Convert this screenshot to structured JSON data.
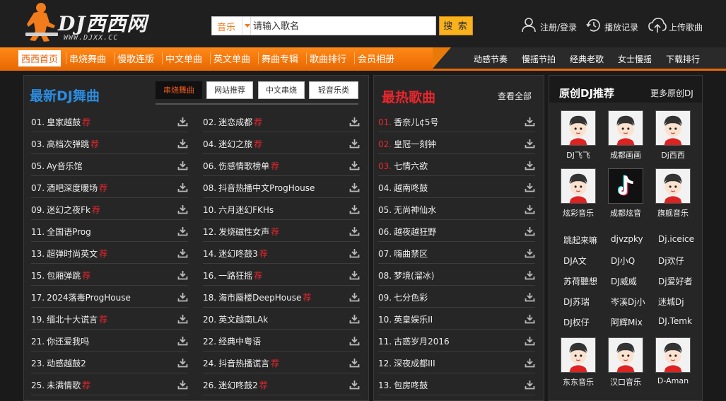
{
  "logo": {
    "text": "DJ西西网",
    "sub": "WWW.DJXX.CC"
  },
  "search": {
    "type_label": "音乐",
    "placeholder": "请输入歌名",
    "button": "搜 索"
  },
  "header_links": [
    {
      "label": "注册/登录",
      "icon": "user-icon"
    },
    {
      "label": "播放记录",
      "icon": "clock-icon"
    },
    {
      "label": "上传歌曲",
      "icon": "upload-icon"
    }
  ],
  "nav": {
    "main": [
      "西西首页",
      "串烧舞曲",
      "慢歌连版",
      "中文单曲",
      "英文单曲",
      "舞曲专辑",
      "歌曲排行",
      "会员相册"
    ],
    "right": [
      "动感节奏",
      "慢摇节拍",
      "经典老歌",
      "女士慢摇",
      "下载排行"
    ]
  },
  "latest": {
    "title": "最新DJ舞曲",
    "tabs": [
      "串烧舞曲",
      "网站推荐",
      "中文串烧",
      "轻音乐类"
    ],
    "rec_mark": "荐",
    "songs": [
      {
        "rank": "01.",
        "title": "皇家越鼓",
        "rec": true
      },
      {
        "rank": "02.",
        "title": "迷恋成都",
        "rec": true
      },
      {
        "rank": "03.",
        "title": "高档次弹跳",
        "rec": true
      },
      {
        "rank": "04.",
        "title": "迷幻之旅",
        "rec": true
      },
      {
        "rank": "05.",
        "title": "Ay音乐馆",
        "rec": false
      },
      {
        "rank": "06.",
        "title": "伤感情歌榜单",
        "rec": true
      },
      {
        "rank": "07.",
        "title": "酒吧深度暖场",
        "rec": true
      },
      {
        "rank": "08.",
        "title": "抖音热播中文ProgHouse",
        "rec": false
      },
      {
        "rank": "09.",
        "title": "迷幻之夜Fk",
        "rec": true
      },
      {
        "rank": "10.",
        "title": "六月迷幻FKHs",
        "rec": false
      },
      {
        "rank": "11.",
        "title": "全国语Prog",
        "rec": false
      },
      {
        "rank": "12.",
        "title": "发烧磁性女声",
        "rec": true
      },
      {
        "rank": "13.",
        "title": "超弹时尚英文",
        "rec": true
      },
      {
        "rank": "14.",
        "title": "迷幻咚鼓3",
        "rec": true
      },
      {
        "rank": "15.",
        "title": "包厢弹跳",
        "rec": true
      },
      {
        "rank": "16.",
        "title": "一路狂摇",
        "rec": true
      },
      {
        "rank": "17.",
        "title": "2024落毒ProgHouse",
        "rec": false
      },
      {
        "rank": "18.",
        "title": "海市蜃楼DeepHouse",
        "rec": true
      },
      {
        "rank": "19.",
        "title": "缅北十大谎言",
        "rec": true
      },
      {
        "rank": "20.",
        "title": "英文越南LAk",
        "rec": false
      },
      {
        "rank": "21.",
        "title": "你还爱我吗",
        "rec": false
      },
      {
        "rank": "22.",
        "title": "经典中粤语",
        "rec": false
      },
      {
        "rank": "23.",
        "title": "动感越鼓2",
        "rec": false
      },
      {
        "rank": "24.",
        "title": "抖音热播谎言",
        "rec": true
      },
      {
        "rank": "25.",
        "title": "未满情歌",
        "rec": true
      },
      {
        "rank": "26.",
        "title": "迷幻咚鼓2",
        "rec": true
      }
    ]
  },
  "hot": {
    "title": "最热歌曲",
    "more": "查看全部",
    "songs": [
      {
        "rank": "01.",
        "title": "香奈儿¢5号"
      },
      {
        "rank": "02.",
        "title": "皇冠一刻钟"
      },
      {
        "rank": "03.",
        "title": "七情六欲"
      },
      {
        "rank": "04.",
        "title": "越南咚鼓"
      },
      {
        "rank": "05.",
        "title": "无尚神仙水"
      },
      {
        "rank": "06.",
        "title": "越夜越狂野"
      },
      {
        "rank": "07.",
        "title": "嗨曲禁区"
      },
      {
        "rank": "08.",
        "title": "梦境(溜冰)"
      },
      {
        "rank": "09.",
        "title": "七分色彩"
      },
      {
        "rank": "10.",
        "title": "英皇娱乐II"
      },
      {
        "rank": "11.",
        "title": "古惑岁月2016"
      },
      {
        "rank": "12.",
        "title": "深夜成都III"
      },
      {
        "rank": "13.",
        "title": "包房咚鼓"
      }
    ]
  },
  "original": {
    "title": "原创DJ推荐",
    "more": "更多原创DJ",
    "top_djs": [
      "DJ飞飞",
      "成都画画",
      "Dj西西",
      "炫彩音乐",
      "成都炫音",
      "旗舰音乐"
    ],
    "name_links": [
      "跳起来嘛",
      "djvzpky",
      "Dj.iceice",
      "DJA文",
      "DJ小Q",
      "Dj欢仔",
      "苏荷聽想",
      "DJ威威",
      "Dj爱好者",
      "DJ苏瑞",
      "岑溪Dj小",
      "迷城Dj",
      "DJ权仔",
      "阿辉Mix",
      "DJ.Temk"
    ],
    "bottom_djs": [
      "东东音乐",
      "汉口音乐",
      "D-Aman"
    ]
  },
  "colors": {
    "accent": "#e96a04",
    "blue": "#2b8cdf",
    "red": "#e8262d",
    "button": "#f9b11c"
  }
}
